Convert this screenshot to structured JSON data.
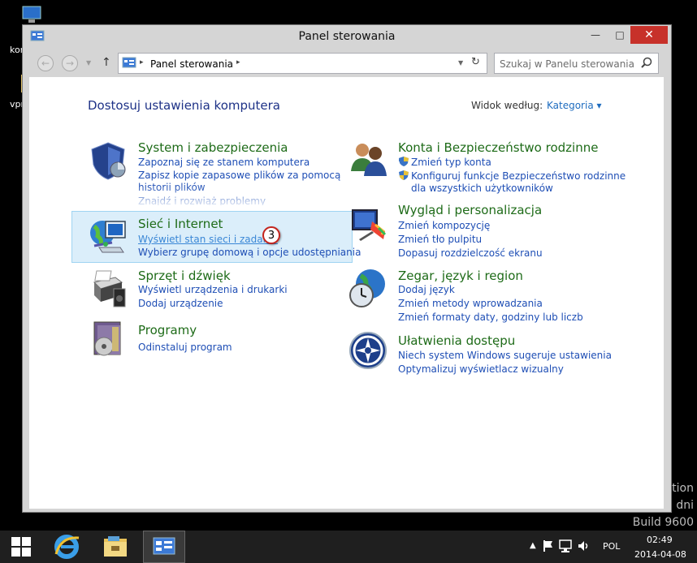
{
  "desktop": {
    "icon_labels": [
      "kor",
      "vpr"
    ],
    "watermark_lines": [
      "ation",
      "dni",
      "Build 9600"
    ]
  },
  "window": {
    "title": "Panel sterowania",
    "close_label": "✕",
    "minimize_label": "—",
    "maximize_label": "□"
  },
  "navbar": {
    "back_glyph": "←",
    "forward_glyph": "→",
    "up_glyph": "↑",
    "breadcrumb": "Panel sterowania",
    "breadcrumb_sep": "▸",
    "search_placeholder": "Szukaj w Panelu sterowania"
  },
  "main": {
    "heading": "Dostosuj ustawienia komputera",
    "view_by_label": "Widok według:",
    "view_by_value": "Kategoria ▾",
    "badge_number": "3",
    "categories_left": [
      {
        "title": "System i zabezpieczenia",
        "links": [
          "Zapoznaj się ze stanem komputera",
          "Zapisz kopie zapasowe plików za pomocą",
          "historii plików",
          "Znajdź i rozwiąż problemy"
        ]
      },
      {
        "title": "Sieć i Internet",
        "links": [
          "Wyświetl stan sieci i zadania",
          "Wybierz grupę domową i opcje udostępniania"
        ]
      },
      {
        "title": "Sprzęt i dźwięk",
        "links": [
          "Wyświetl urządzenia i drukarki",
          "Dodaj urządzenie"
        ]
      },
      {
        "title": "Programy",
        "links": [
          "Odinstaluj program"
        ]
      }
    ],
    "categories_right": [
      {
        "title": "Konta i Bezpieczeństwo rodzinne",
        "links": [
          "Zmień typ konta",
          "Konfiguruj funkcje Bezpieczeństwo rodzinne",
          "dla wszystkich użytkowników"
        ]
      },
      {
        "title": "Wygląd i personalizacja",
        "links": [
          "Zmień kompozycję",
          "Zmień tło pulpitu",
          "Dopasuj rozdzielczość ekranu"
        ]
      },
      {
        "title": "Zegar, język i region",
        "links": [
          "Dodaj język",
          "Zmień metody wprowadzania",
          "Zmień formaty daty, godziny lub liczb"
        ]
      },
      {
        "title": "Ułatwienia dostępu",
        "links": [
          "Niech system Windows sugeruje ustawienia",
          "Optymalizuj wyświetlacz wizualny"
        ]
      }
    ]
  },
  "taskbar": {
    "language": "POL",
    "time": "02:49",
    "date": "2014-04-08"
  },
  "colors": {
    "category_title": "#1e6b18",
    "link": "#1e4eb5",
    "heading": "#1e3287",
    "close_button": "#c7312a",
    "highlight": "#dbeefa"
  }
}
